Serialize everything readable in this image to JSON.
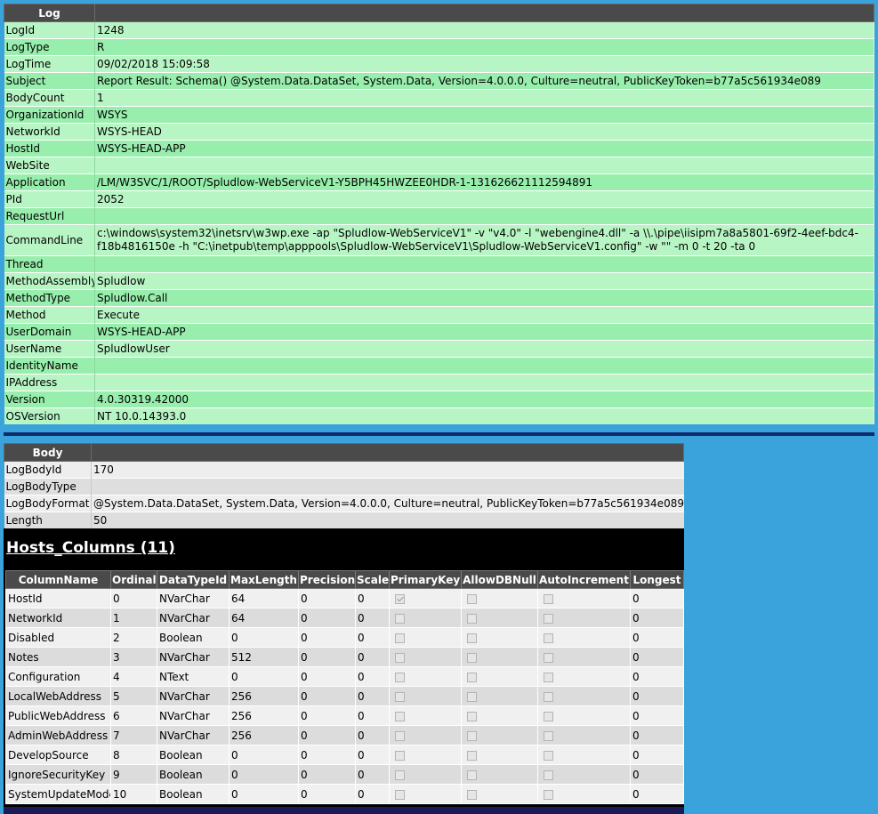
{
  "log": {
    "header": "Log",
    "rows": [
      {
        "key": "LogId",
        "value": "1248"
      },
      {
        "key": "LogType",
        "value": "R"
      },
      {
        "key": "LogTime",
        "value": "09/02/2018 15:09:58"
      },
      {
        "key": "Subject",
        "value": "Report Result: Schema() @System.Data.DataSet, System.Data, Version=4.0.0.0, Culture=neutral, PublicKeyToken=b77a5c561934e089"
      },
      {
        "key": "BodyCount",
        "value": "1"
      },
      {
        "key": "OrganizationId",
        "value": "WSYS"
      },
      {
        "key": "NetworkId",
        "value": "WSYS-HEAD"
      },
      {
        "key": "HostId",
        "value": "WSYS-HEAD-APP"
      },
      {
        "key": "WebSite",
        "value": ""
      },
      {
        "key": "Application",
        "value": "/LM/W3SVC/1/ROOT/Spludlow-WebServiceV1-Y5BPH45HWZEE0HDR-1-131626621112594891"
      },
      {
        "key": "PId",
        "value": "2052"
      },
      {
        "key": "RequestUrl",
        "value": ""
      },
      {
        "key": "CommandLine",
        "value": "c:\\windows\\system32\\inetsrv\\w3wp.exe -ap \"Spludlow-WebServiceV1\" -v \"v4.0\" -l \"webengine4.dll\" -a \\\\.\\pipe\\iisipm7a8a5801-69f2-4eef-bdc4-f18b4816150e -h \"C:\\inetpub\\temp\\apppools\\Spludlow-WebServiceV1\\Spludlow-WebServiceV1.config\" -w \"\" -m 0 -t 20 -ta 0"
      },
      {
        "key": "Thread",
        "value": ""
      },
      {
        "key": "MethodAssembly",
        "value": "Spludlow"
      },
      {
        "key": "MethodType",
        "value": "Spludlow.Call"
      },
      {
        "key": "Method",
        "value": "Execute"
      },
      {
        "key": "UserDomain",
        "value": "WSYS-HEAD-APP"
      },
      {
        "key": "UserName",
        "value": "SpludlowUser"
      },
      {
        "key": "IdentityName",
        "value": ""
      },
      {
        "key": "IPAddress",
        "value": ""
      },
      {
        "key": "Version",
        "value": "4.0.30319.42000"
      },
      {
        "key": "OSVersion",
        "value": "NT 10.0.14393.0"
      }
    ]
  },
  "body": {
    "header": "Body",
    "rows": [
      {
        "key": "LogBodyId",
        "value": "170"
      },
      {
        "key": "LogBodyType",
        "value": ""
      },
      {
        "key": "LogBodyFormat",
        "value": "@System.Data.DataSet, System.Data, Version=4.0.0.0, Culture=neutral, PublicKeyToken=b77a5c561934e089"
      },
      {
        "key": "Length",
        "value": "50"
      }
    ]
  },
  "columns_panel": {
    "title": "Hosts_Columns (11)",
    "headers": [
      "ColumnName",
      "Ordinal",
      "DataTypeId",
      "MaxLength",
      "Precision",
      "Scale",
      "PrimaryKey",
      "AllowDBNull",
      "AutoIncrement",
      "Longest"
    ],
    "rows": [
      {
        "name": "HostId",
        "ordinal": "0",
        "type": "NVarChar",
        "maxlen": "64",
        "precision": "0",
        "scale": "0",
        "pk": true,
        "nullable": false,
        "autoinc": false,
        "longest": "0"
      },
      {
        "name": "NetworkId",
        "ordinal": "1",
        "type": "NVarChar",
        "maxlen": "64",
        "precision": "0",
        "scale": "0",
        "pk": false,
        "nullable": false,
        "autoinc": false,
        "longest": "0"
      },
      {
        "name": "Disabled",
        "ordinal": "2",
        "type": "Boolean",
        "maxlen": "0",
        "precision": "0",
        "scale": "0",
        "pk": false,
        "nullable": false,
        "autoinc": false,
        "longest": "0"
      },
      {
        "name": "Notes",
        "ordinal": "3",
        "type": "NVarChar",
        "maxlen": "512",
        "precision": "0",
        "scale": "0",
        "pk": false,
        "nullable": false,
        "autoinc": false,
        "longest": "0"
      },
      {
        "name": "Configuration",
        "ordinal": "4",
        "type": "NText",
        "maxlen": "0",
        "precision": "0",
        "scale": "0",
        "pk": false,
        "nullable": false,
        "autoinc": false,
        "longest": "0"
      },
      {
        "name": "LocalWebAddress",
        "ordinal": "5",
        "type": "NVarChar",
        "maxlen": "256",
        "precision": "0",
        "scale": "0",
        "pk": false,
        "nullable": false,
        "autoinc": false,
        "longest": "0"
      },
      {
        "name": "PublicWebAddress",
        "ordinal": "6",
        "type": "NVarChar",
        "maxlen": "256",
        "precision": "0",
        "scale": "0",
        "pk": false,
        "nullable": false,
        "autoinc": false,
        "longest": "0"
      },
      {
        "name": "AdminWebAddress",
        "ordinal": "7",
        "type": "NVarChar",
        "maxlen": "256",
        "precision": "0",
        "scale": "0",
        "pk": false,
        "nullable": false,
        "autoinc": false,
        "longest": "0"
      },
      {
        "name": "DevelopSource",
        "ordinal": "8",
        "type": "Boolean",
        "maxlen": "0",
        "precision": "0",
        "scale": "0",
        "pk": false,
        "nullable": false,
        "autoinc": false,
        "longest": "0"
      },
      {
        "name": "IgnoreSecurityKey",
        "ordinal": "9",
        "type": "Boolean",
        "maxlen": "0",
        "precision": "0",
        "scale": "0",
        "pk": false,
        "nullable": false,
        "autoinc": false,
        "longest": "0"
      },
      {
        "name": "SystemUpdateMode",
        "ordinal": "10",
        "type": "Boolean",
        "maxlen": "0",
        "precision": "0",
        "scale": "0",
        "pk": false,
        "nullable": false,
        "autoinc": false,
        "longest": "0"
      }
    ]
  },
  "colors": {
    "page_background": "#3aa3dc",
    "header_background": "#4a4a4a",
    "log_row_light": "#b8f5c4",
    "log_row_dark": "#98eeac",
    "divider": "#102a6e"
  }
}
